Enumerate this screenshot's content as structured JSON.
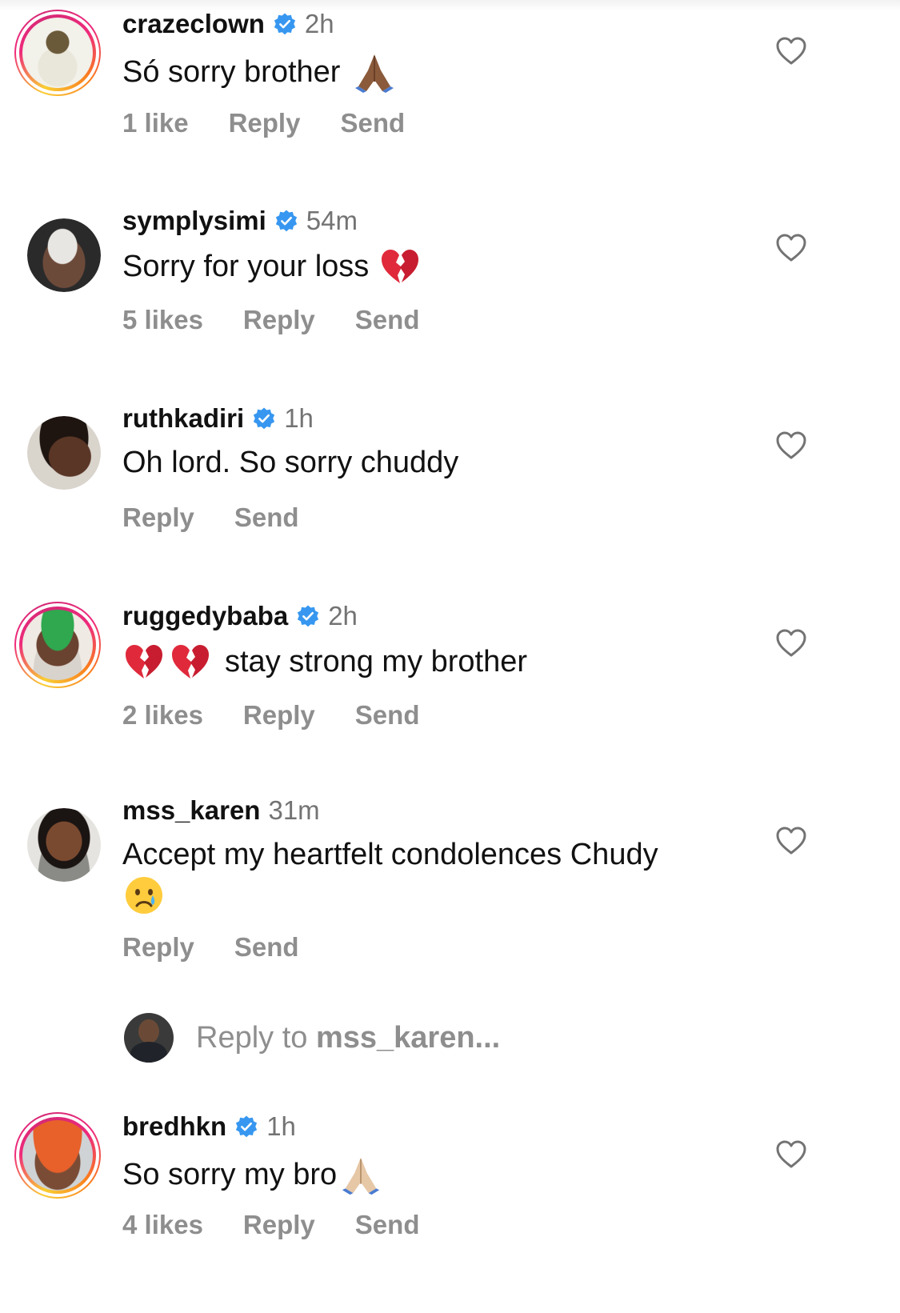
{
  "comments": [
    {
      "username": "crazeclown",
      "verified": true,
      "time": "2h",
      "text": "Só sorry brother",
      "likes": "1 like",
      "reply": "Reply",
      "send": "Send",
      "story_ring": true
    },
    {
      "username": "symplysimi",
      "verified": true,
      "time": "54m",
      "text": "Sorry for your loss",
      "likes": "5 likes",
      "reply": "Reply",
      "send": "Send",
      "story_ring": false
    },
    {
      "username": "ruthkadiri",
      "verified": true,
      "time": "1h",
      "text": "Oh lord. So sorry chuddy",
      "likes": "",
      "reply": "Reply",
      "send": "Send",
      "story_ring": false
    },
    {
      "username": "ruggedybaba",
      "verified": true,
      "time": "2h",
      "text": "stay strong my brother",
      "likes": "2 likes",
      "reply": "Reply",
      "send": "Send",
      "story_ring": true
    },
    {
      "username": "mss_karen",
      "verified": false,
      "time": "31m",
      "text": "Accept my heartfelt condolences Chudy",
      "likes": "",
      "reply": "Reply",
      "send": "Send",
      "story_ring": false
    },
    {
      "username": "bredhkn",
      "verified": true,
      "time": "1h",
      "text": "So sorry my bro",
      "likes": "4 likes",
      "reply": "Reply",
      "send": "Send",
      "story_ring": true
    }
  ],
  "reply_box": {
    "prefix": "Reply to ",
    "target": "mss_karen..."
  },
  "colors": {
    "verified": "#3797f0",
    "muted": "#8e8e8e",
    "time": "#737373"
  },
  "icons": {
    "heart": "heart-outline-icon",
    "verified": "verified-badge-icon",
    "pray": "folded-hands-emoji",
    "broken_heart": "broken-heart-emoji",
    "crying": "crying-face-emoji"
  }
}
